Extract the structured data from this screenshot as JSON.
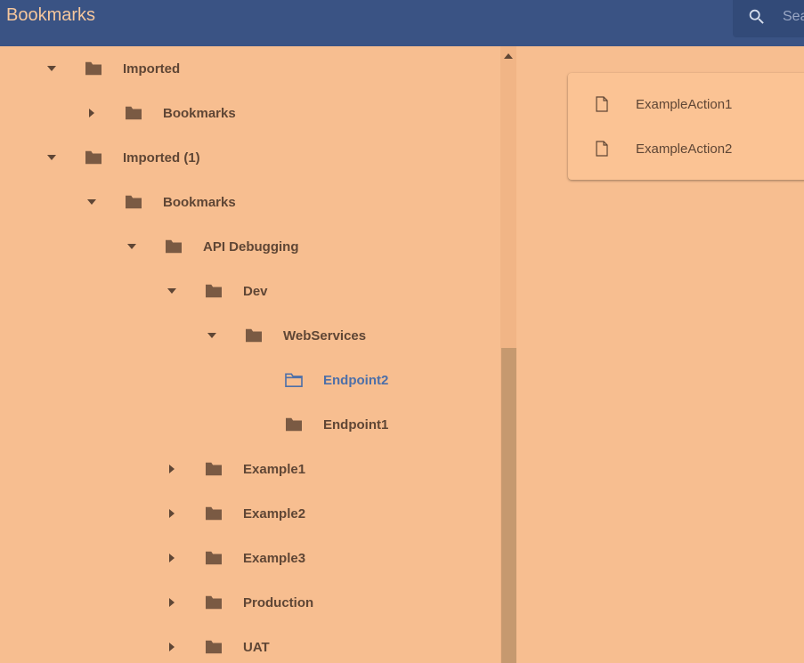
{
  "header": {
    "title": "Bookmarks",
    "search_placeholder": "Search"
  },
  "colors": {
    "header_bg": "#3a5384",
    "content_bg": "#f7be90",
    "text": "#5f4635",
    "selected": "#4d6fa8"
  },
  "tree": [
    {
      "label": "Imported",
      "state": "expanded",
      "depth": 1,
      "icon": "folder-icon"
    },
    {
      "label": "Bookmarks",
      "state": "collapsed",
      "depth": 2,
      "icon": "folder-icon"
    },
    {
      "label": "Imported (1)",
      "state": "expanded",
      "depth": 1,
      "icon": "folder-icon"
    },
    {
      "label": "Bookmarks",
      "state": "expanded",
      "depth": 2,
      "icon": "folder-icon"
    },
    {
      "label": "API Debugging",
      "state": "expanded",
      "depth": 3,
      "icon": "folder-icon"
    },
    {
      "label": "Dev",
      "state": "expanded",
      "depth": 4,
      "icon": "folder-icon"
    },
    {
      "label": "WebServices",
      "state": "expanded",
      "depth": 5,
      "icon": "folder-icon"
    },
    {
      "label": "Endpoint2",
      "state": "leaf",
      "depth": 6,
      "icon": "folder-outline-icon",
      "selected": true
    },
    {
      "label": "Endpoint1",
      "state": "leaf",
      "depth": 6,
      "icon": "folder-icon"
    },
    {
      "label": "Example1",
      "state": "collapsed",
      "depth": 4,
      "icon": "folder-icon"
    },
    {
      "label": "Example2",
      "state": "collapsed",
      "depth": 4,
      "icon": "folder-icon"
    },
    {
      "label": "Example3",
      "state": "collapsed",
      "depth": 4,
      "icon": "folder-icon"
    },
    {
      "label": "Production",
      "state": "collapsed",
      "depth": 4,
      "icon": "folder-icon"
    },
    {
      "label": "UAT",
      "state": "collapsed",
      "depth": 4,
      "icon": "folder-icon"
    }
  ],
  "actions": [
    {
      "label": "ExampleAction1",
      "icon": "file-icon"
    },
    {
      "label": "ExampleAction2",
      "icon": "file-icon"
    }
  ]
}
